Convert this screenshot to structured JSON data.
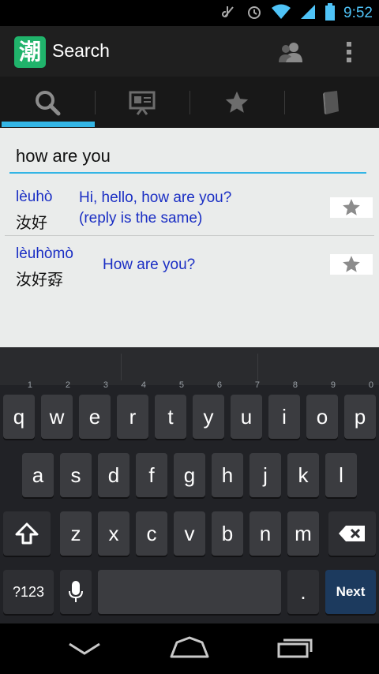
{
  "status": {
    "time": "9:52"
  },
  "action_bar": {
    "logo_char": "潮",
    "title": "Search"
  },
  "search": {
    "query": "how are you"
  },
  "results": [
    {
      "pinyin": "lèuhò",
      "hanzi": "汝好",
      "meaning_lines": [
        "Hi, hello, how are you?",
        "(reply is the same)"
      ]
    },
    {
      "pinyin": "lèuhòmò",
      "hanzi": "汝好孬",
      "meaning_lines": [
        "How are you?"
      ]
    }
  ],
  "keyboard": {
    "row1": [
      "q",
      "w",
      "e",
      "r",
      "t",
      "y",
      "u",
      "i",
      "o",
      "p"
    ],
    "row1_hints": [
      "1",
      "2",
      "3",
      "4",
      "5",
      "6",
      "7",
      "8",
      "9",
      "0"
    ],
    "row2": [
      "a",
      "s",
      "d",
      "f",
      "g",
      "h",
      "j",
      "k",
      "l"
    ],
    "row3": [
      "z",
      "x",
      "c",
      "v",
      "b",
      "n",
      "m"
    ],
    "symbols_label": "?123",
    "period_label": ".",
    "next_label": "Next"
  },
  "colors": {
    "accent": "#33b5e5",
    "result_text": "#1a2ec4",
    "logo_green": "#20b36b"
  }
}
